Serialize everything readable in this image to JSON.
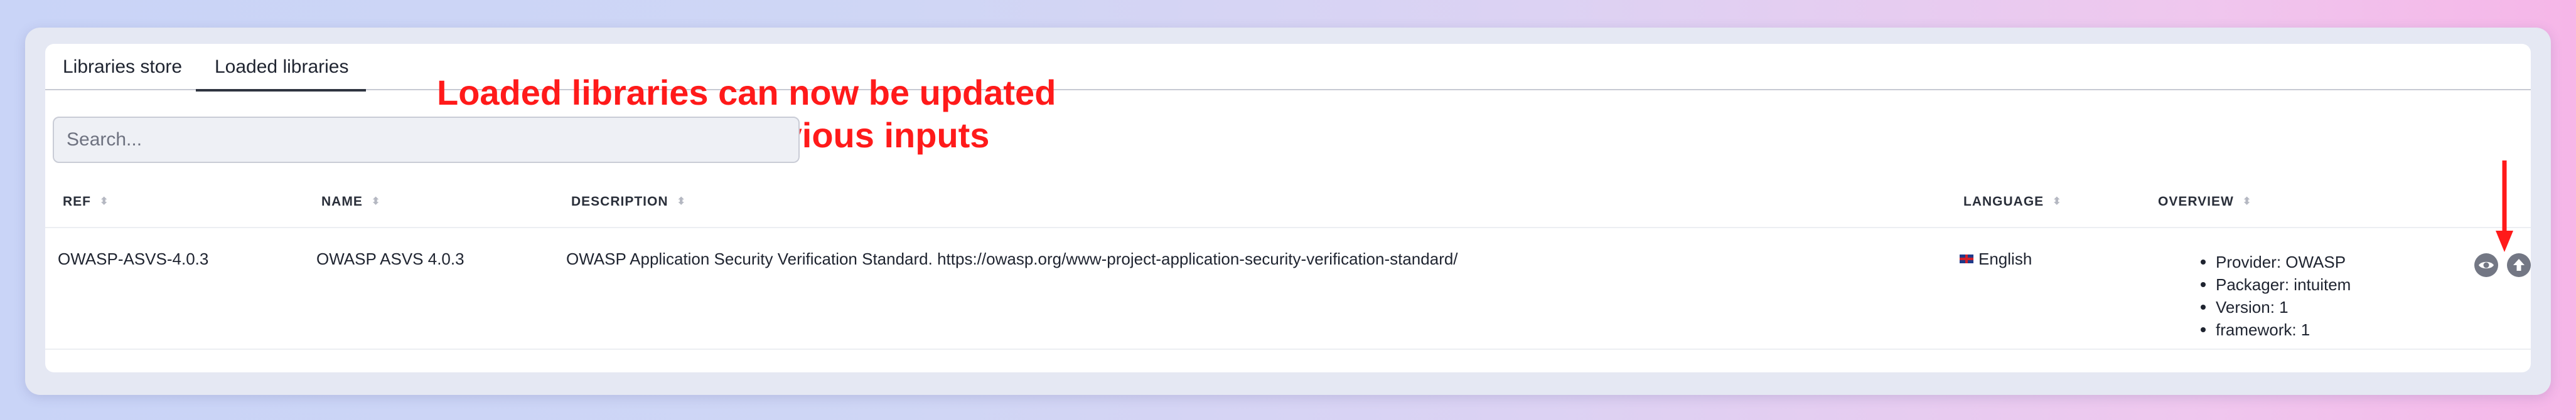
{
  "tabs": [
    {
      "label": "Libraries store",
      "active": false
    },
    {
      "label": "Loaded libraries",
      "active": true
    }
  ],
  "annotation": {
    "line1": "Loaded libraries can now be updated",
    "line2": "without affecting previous inputs",
    "color": "#ff1a1a"
  },
  "search": {
    "placeholder": "Search...",
    "value": ""
  },
  "table": {
    "headers": [
      "REF",
      "NAME",
      "DESCRIPTION",
      "LANGUAGE",
      "OVERVIEW"
    ],
    "rows": [
      {
        "ref": "OWASP-ASVS-4.0.3",
        "name": "OWASP ASVS 4.0.3",
        "description": "OWASP Application Security Verification Standard. https://owasp.org/www-project-application-security-verification-standard/",
        "language": "English",
        "language_icon": "uk-flag-icon",
        "overview": [
          "Provider: OWASP",
          "Packager: intuitem",
          "Version: 1",
          "framework: 1"
        ],
        "actions": [
          "eye-icon",
          "upload-icon"
        ]
      }
    ]
  }
}
